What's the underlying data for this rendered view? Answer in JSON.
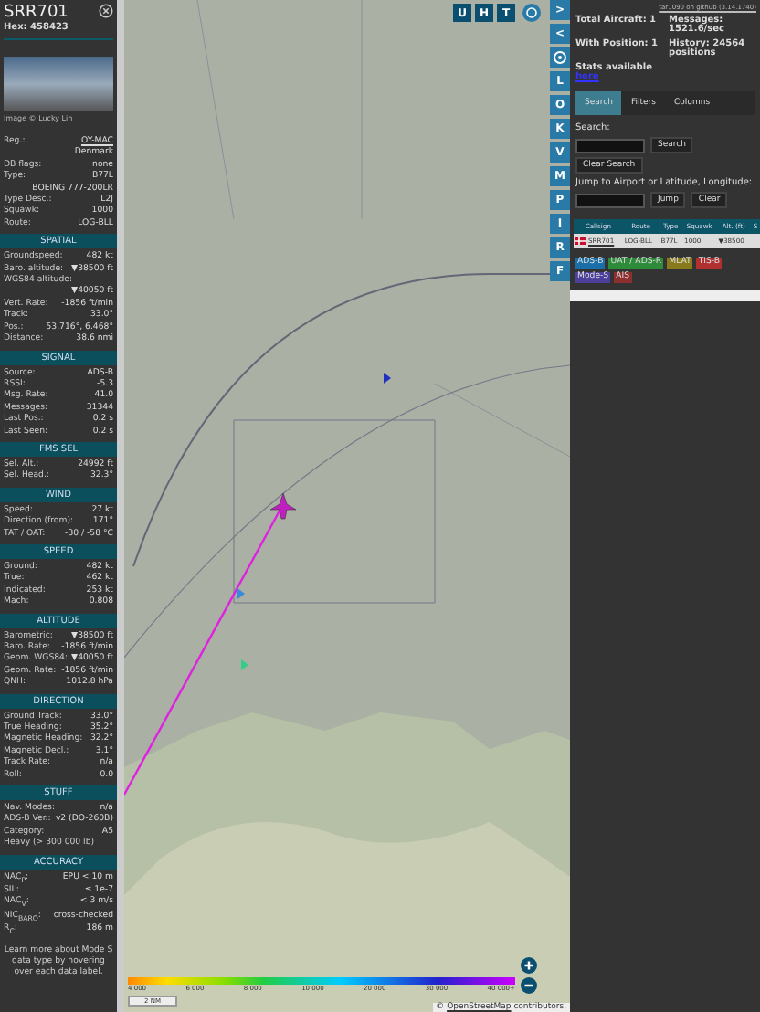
{
  "aircraft": {
    "callsign": "SRR701",
    "hex": "Hex: 458423",
    "photo_credit": "Image © Lucky Lin",
    "info": [
      {
        "label": "Reg.:",
        "link": "OY-MAC"
      },
      {
        "value": "Denmark"
      },
      {
        "label": "DB flags:",
        "value": "none"
      },
      {
        "label": "Type:",
        "value": "B77L"
      },
      {
        "value": "BOEING 777-200LR"
      },
      {
        "label": "Type Desc.:",
        "value": "L2J"
      },
      {
        "label": "Squawk:",
        "value": "1000"
      },
      {
        "label": "Route:",
        "value": "LOG-BLL"
      }
    ],
    "sections": [
      {
        "title": "SPATIAL",
        "rows": [
          {
            "label": "Groundspeed:",
            "value": "482 kt"
          },
          {
            "label": "Baro. altitude:",
            "value": "▼38500 ft"
          },
          {
            "label": "WGS84 altitude:"
          },
          {
            "value": "▼40050 ft"
          },
          {
            "label": "Vert. Rate:",
            "value": "-1856 ft/min"
          },
          {
            "label": "Track:",
            "value": "33.0°"
          },
          {
            "label": "Pos.:",
            "value": "53.716°, 6.468°"
          },
          {
            "label": "Distance:",
            "value": "38.6 nmi"
          }
        ]
      },
      {
        "title": "SIGNAL",
        "rows": [
          {
            "label": "Source:",
            "value": "ADS-B"
          },
          {
            "label": "RSSI:",
            "value": "-5.3"
          },
          {
            "label": "Msg. Rate:",
            "value": "41.0"
          },
          {
            "label": "Messages:",
            "value": "31344"
          },
          {
            "label": "Last Pos.:",
            "value": "0.2 s"
          },
          {
            "label": "Last Seen:",
            "value": "0.2 s"
          }
        ]
      },
      {
        "title": "FMS SEL",
        "rows": [
          {
            "label": "Sel. Alt.:",
            "value": "24992 ft"
          },
          {
            "label": "Sel. Head.:",
            "value": "32.3°"
          }
        ]
      },
      {
        "title": "WIND",
        "rows": [
          {
            "label": "Speed:",
            "value": "27 kt"
          },
          {
            "label": "Direction (from):",
            "value": "171°"
          },
          {
            "label": "TAT / OAT:",
            "value": "-30 / -58 °C"
          }
        ]
      },
      {
        "title": "SPEED",
        "rows": [
          {
            "label": "Ground:",
            "value": "482 kt"
          },
          {
            "label": "True:",
            "value": "462 kt"
          },
          {
            "label": "Indicated:",
            "value": "253 kt"
          },
          {
            "label": "Mach:",
            "value": "0.808"
          }
        ]
      },
      {
        "title": "ALTITUDE",
        "rows": [
          {
            "label": "Barometric:",
            "value": "▼38500 ft"
          },
          {
            "label": "Baro. Rate:",
            "value": "-1856 ft/min"
          },
          {
            "label": "Geom. WGS84:",
            "value": "▼40050 ft"
          },
          {
            "label": "Geom. Rate:",
            "value": "-1856 ft/min"
          },
          {
            "label": "QNH:",
            "value": "1012.8 hPa"
          }
        ]
      },
      {
        "title": "DIRECTION",
        "rows": [
          {
            "label": "Ground Track:",
            "value": "33.0°"
          },
          {
            "label": "True Heading:",
            "value": "35.2°"
          },
          {
            "label": "Magnetic Heading:",
            "value": "32.2°"
          },
          {
            "label": "Magnetic Decl.:",
            "value": "3.1°"
          },
          {
            "label": "Track Rate:",
            "value": "n/a"
          },
          {
            "label": "Roll:",
            "value": "0.0"
          }
        ]
      },
      {
        "title": "STUFF",
        "rows": [
          {
            "label": "Nav. Modes:",
            "value": "n/a"
          },
          {
            "label": "ADS-B Ver.:",
            "value": "v2 (DO-260B)"
          },
          {
            "label": "Category:",
            "value": "A5"
          },
          {
            "label": "Heavy (> 300 000 lb)"
          }
        ]
      },
      {
        "title": "ACCURACY",
        "rows": [
          {
            "label": "NAC$_{P}$:",
            "value": "EPU < 10 m"
          },
          {
            "label": "SIL:",
            "value": "≤ 1e-7"
          },
          {
            "label": "NAC$_{V}$:",
            "value": "< 3 m/s"
          },
          {
            "label": "NIC$_{BARO}$:",
            "value": "cross-checked"
          },
          {
            "label": "R$_{C}$:",
            "value": "186 m"
          }
        ]
      }
    ],
    "footer": "Learn more about Mode S data type by hovering over each data label."
  },
  "map": {
    "top_buttons": [
      "U",
      "H",
      "T"
    ],
    "side_buttons": [
      {
        "kind": "text",
        "label": ">"
      },
      {
        "kind": "text",
        "label": "<"
      },
      {
        "kind": "settings"
      },
      {
        "kind": "text",
        "label": "L"
      },
      {
        "kind": "text",
        "label": "O"
      },
      {
        "kind": "text",
        "label": "K"
      },
      {
        "kind": "text",
        "label": "V"
      },
      {
        "kind": "text",
        "label": "M"
      },
      {
        "kind": "text",
        "label": "P"
      },
      {
        "kind": "text",
        "label": "I"
      },
      {
        "kind": "text",
        "label": "R"
      },
      {
        "kind": "text",
        "label": "F"
      }
    ],
    "altitude_scale": [
      "4 000",
      "6 000",
      "8 000",
      "10 000",
      "20 000",
      "30 000",
      "40 000+"
    ],
    "scale_label": "2 NM",
    "attribution_prefix": "©",
    "attribution_link": "OpenStreetMap",
    "attribution_suffix": "contributors."
  },
  "panel": {
    "version_link": "tar1090 on github (3.14.1740)",
    "total": "Total Aircraft: 1",
    "messages": "Messages: 1521.6/sec",
    "with_position": "With Position: 1",
    "history": "History: 24564 positions",
    "stats": "Stats available",
    "stats_link": "here",
    "tabs": [
      {
        "label": "Search",
        "selected": true
      },
      {
        "label": "Filters",
        "selected": false
      },
      {
        "label": "Columns",
        "selected": false
      }
    ],
    "search_label": "Search:",
    "search_button": "Search",
    "clear_search": "Clear Search",
    "jump_label": "Jump to Airport or Latitude, Longitude:",
    "jump_button": "Jump",
    "clear_button": "Clear",
    "table": {
      "columns": [
        "Callsign",
        "Route",
        "Type",
        "Squawk",
        "Alt. (ft)",
        "S"
      ],
      "rows": [
        {
          "cells": [
            "SRR701",
            "LOG-BLL",
            "B77L",
            "1000",
            "▼38500"
          ]
        }
      ]
    },
    "sources": [
      {
        "label": "ADS-B",
        "color": "#1a6fa8"
      },
      {
        "label": "UAT / ADS-R",
        "color": "#2e8b3a"
      },
      {
        "label": "MLAT",
        "color": "#8a7a1e"
      },
      {
        "label": "TIS-B",
        "color": "#b03030"
      },
      {
        "label": "Mode-S",
        "color": "#4b3f9a"
      },
      {
        "label": "AIS",
        "color": "#8b2f2f"
      }
    ]
  }
}
